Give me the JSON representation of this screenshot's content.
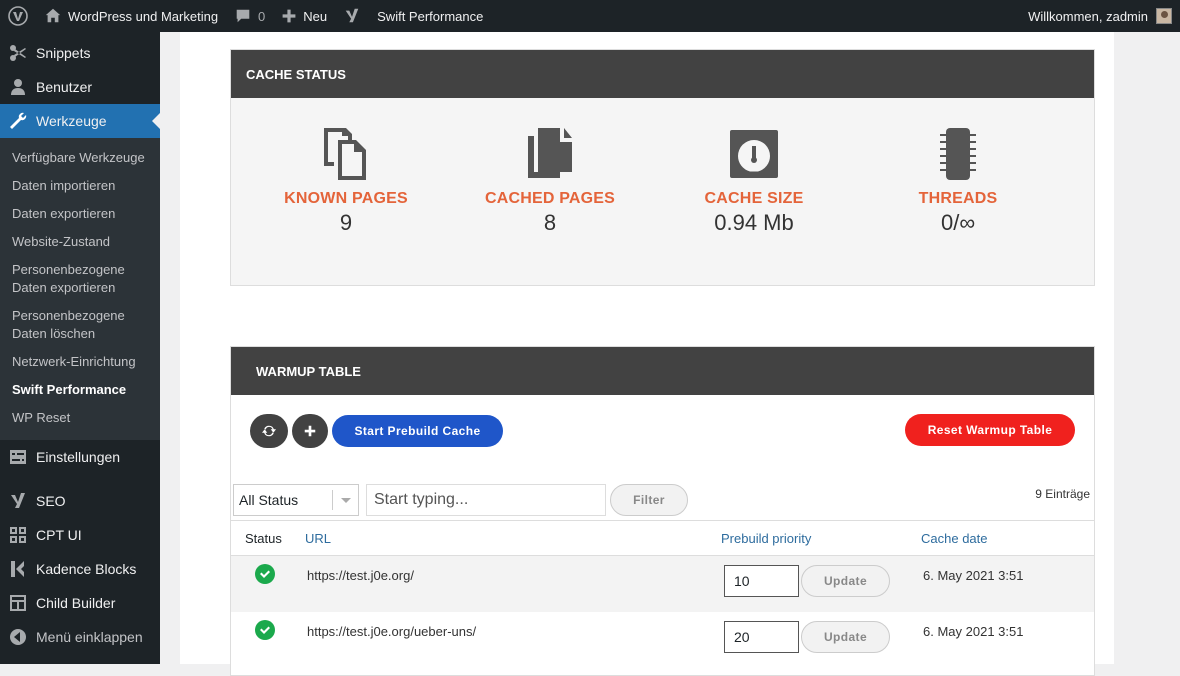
{
  "adminbar": {
    "site_name": "WordPress und Marketing",
    "comments_count": "0",
    "new_label": "Neu",
    "plugin_label": "Swift Performance",
    "welcome": "Willkommen, zadmin"
  },
  "sidebar": {
    "items_top": [
      {
        "label": "Snippets",
        "icon": "scissors-icon"
      },
      {
        "label": "Benutzer",
        "icon": "user-icon"
      },
      {
        "label": "Werkzeuge",
        "icon": "wrench-icon"
      }
    ],
    "submenu": [
      "Verfügbare Werkzeuge",
      "Daten importieren",
      "Daten exportieren",
      "Website-Zustand",
      "Personenbezogene Daten exportieren",
      "Personenbezogene Daten löschen",
      "Netzwerk-Einrichtung",
      "Swift Performance",
      "WP Reset"
    ],
    "items_bottom": [
      {
        "label": "Einstellungen",
        "icon": "sliders-icon"
      },
      {
        "label": "SEO",
        "icon": "yoast-icon"
      },
      {
        "label": "CPT UI",
        "icon": "grid-icon"
      },
      {
        "label": "Kadence Blocks",
        "icon": "kadence-icon"
      },
      {
        "label": "Child Builder",
        "icon": "layout-icon"
      },
      {
        "label": "Menü einklappen",
        "icon": "collapse-icon"
      }
    ]
  },
  "cache_status": {
    "title": "CACHE STATUS",
    "stats": [
      {
        "label": "KNOWN PAGES",
        "value": "9",
        "icon": "copy-icon"
      },
      {
        "label": "CACHED PAGES",
        "value": "8",
        "icon": "files-icon"
      },
      {
        "label": "CACHE SIZE",
        "value": "0.94 Mb",
        "icon": "gauge-icon"
      },
      {
        "label": "THREADS",
        "value": "0/∞",
        "icon": "chip-icon"
      }
    ]
  },
  "warmup": {
    "title": "WARMUP TABLE",
    "start_label": "Start Prebuild Cache",
    "reset_label": "Reset Warmup Table",
    "status_select": "All Status",
    "search_placeholder": "Start typing...",
    "filter_label": "Filter",
    "count": "9 Einträge",
    "columns": {
      "status": "Status",
      "url": "URL",
      "priority": "Prebuild priority",
      "date": "Cache date"
    },
    "rows": [
      {
        "url": "https://test.j0e.org/",
        "priority": "10",
        "update": "Update",
        "date": "6. May 2021 3:51"
      },
      {
        "url": "https://test.j0e.org/ueber-uns/",
        "priority": "20",
        "update": "Update",
        "date": "6. May 2021 3:51"
      }
    ]
  },
  "colors": {
    "accent": "#e4643a",
    "header": "#424242",
    "blue_button": "#1f56c9",
    "red_button": "#f0211e",
    "success": "#1ba94c"
  }
}
